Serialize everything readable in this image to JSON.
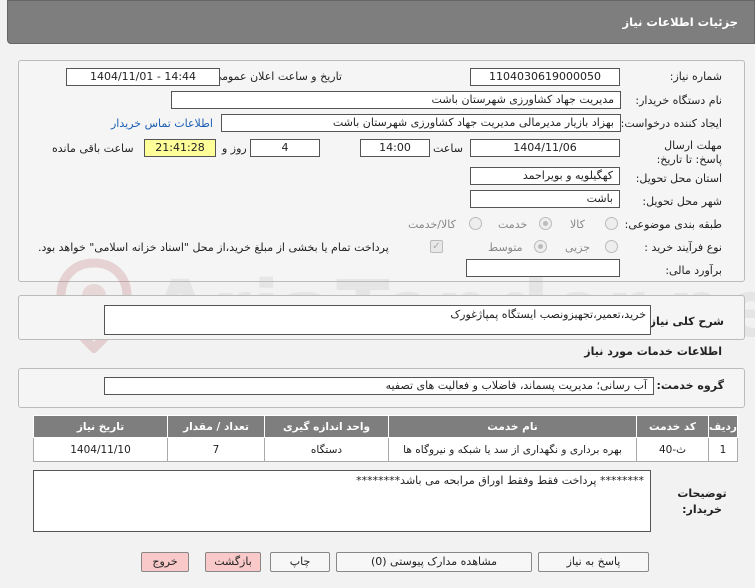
{
  "header": {
    "title": "جزئیات اطلاعات نیاز"
  },
  "fields": {
    "need_number_label": "شماره نیاز:",
    "need_number": "1104030619000050",
    "announce_label": "تاریخ و ساعت اعلان عمومی:",
    "announce_value": "1404/11/01 - 14:44",
    "buyer_org_label": "نام دستگاه خریدار:",
    "buyer_org": "مدیریت جهاد کشاورزی شهرستان باشت",
    "creator_label": "ایجاد کننده درخواست:",
    "creator": "بهزاد بازیار مدیرمالی مدیریت جهاد کشاورزی شهرستان باشت",
    "contact_link": "اطلاعات تماس خریدار",
    "deadline_label": "مهلت ارسال پاسخ: تا تاریخ:",
    "deadline_date": "1404/11/06",
    "time_label": "ساعت",
    "deadline_time": "14:00",
    "days_value": "4",
    "days_label": "روز و",
    "remaining_time": "21:41:28",
    "remaining_label": "ساعت باقی مانده",
    "province_label": "استان محل تحویل:",
    "province": "کهگیلویه و بویراحمد",
    "city_label": "شهر محل تحویل:",
    "city": "باشت",
    "category_label": "طبقه بندی موضوعی:",
    "category_options": [
      "کالا",
      "خدمت",
      "کالا/خدمت"
    ],
    "process_label": "نوع فرآیند خرید :",
    "process_options": [
      "جزیی",
      "متوسط"
    ],
    "payment_note": "پرداخت تمام یا بخشی از مبلغ خرید،از محل \"اسناد خزانه اسلامی\" خواهد بود.",
    "estimate_label": "برآورد مالی:",
    "estimate_value": ""
  },
  "summary": {
    "label": "شرح کلی نیاز:",
    "value": "خرید،تعمیر،تجهیزونصب ایستگاه پمپاژغورک"
  },
  "services": {
    "section_title": "اطلاعات خدمات مورد نیاز",
    "group_label": "گروه خدمت:",
    "group_value": "آب رسانی؛ مدیریت پسماند، فاضلاب و فعالیت های تصفیه",
    "columns": [
      "ردیف",
      "کد خدمت",
      "نام خدمت",
      "واحد اندازه گیری",
      "تعداد / مقدار",
      "تاریخ نیاز"
    ],
    "rows": [
      [
        "1",
        "ث-40",
        "بهره برداری و نگهداری از سد یا شبکه و نیروگاه ها",
        "دستگاه",
        "7",
        "1404/11/10"
      ]
    ]
  },
  "buyer_notes": {
    "label": "توضیحات خریدار:",
    "value": "******** پرداخت فقط وفقط اوراق مرابحه می باشد********"
  },
  "buttons": {
    "reply": "پاسخ به نیاز",
    "view_docs": "مشاهده مدارک پیوستی (0)",
    "print": "چاپ",
    "back": "بازگشت",
    "exit": "خروج"
  },
  "colors": {
    "header_bg": "#7e7e7e",
    "highlight": "#ffff99",
    "link": "#1a5fb4",
    "danger_button": "#f9c9c9"
  }
}
